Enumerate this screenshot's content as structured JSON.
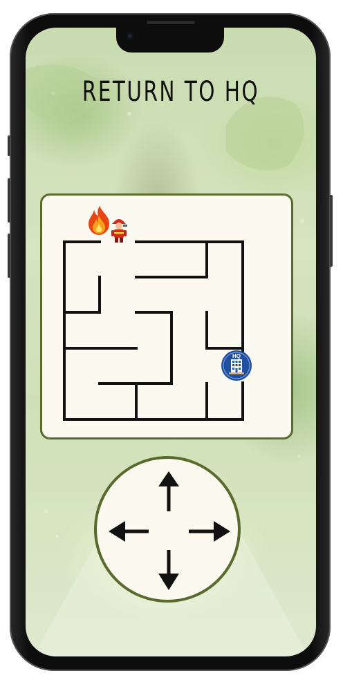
{
  "game": {
    "title": "RETURN TO HQ",
    "player_icon": "firefighter-icon",
    "fire_icon": "fire-icon",
    "goal_icon": "hq-building-icon",
    "goal_label": "HQ"
  },
  "controls": {
    "up": "arrow-up",
    "down": "arrow-down",
    "left": "arrow-left",
    "right": "arrow-right"
  },
  "colors": {
    "panel_border": "#586a2c",
    "panel_fill": "#fbf9f0",
    "maze_wall": "#111111",
    "goal_badge": "#1f4fa3"
  }
}
